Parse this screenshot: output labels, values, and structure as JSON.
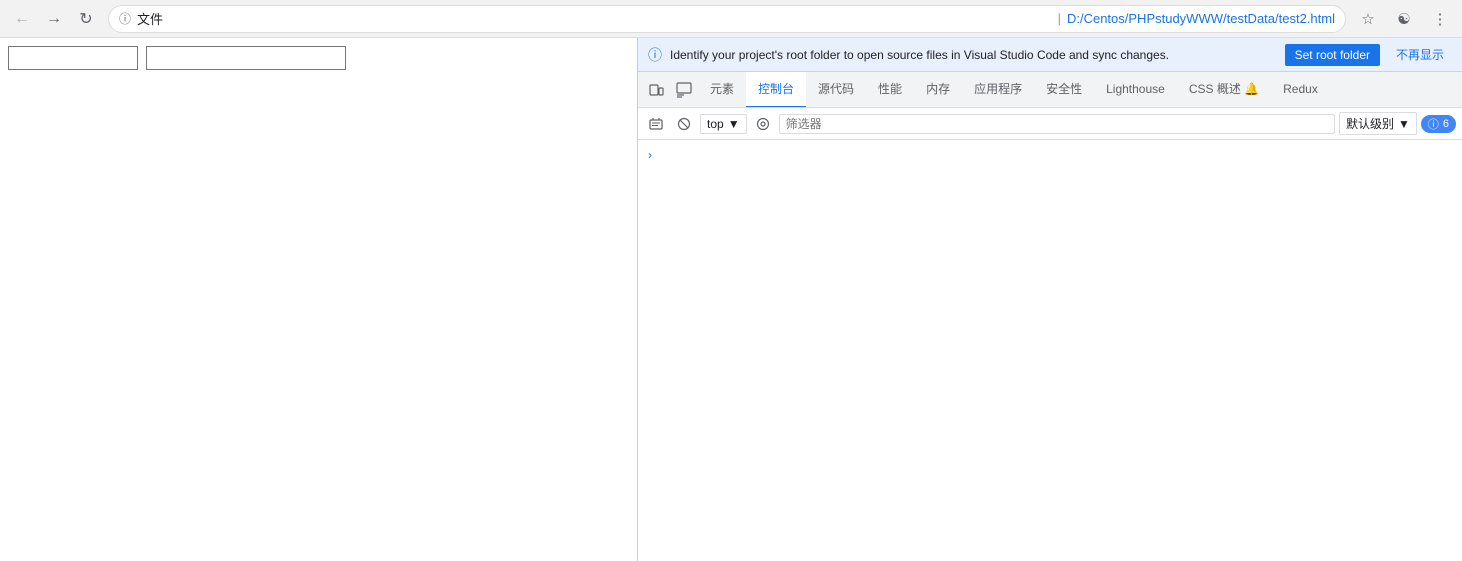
{
  "browser": {
    "back_title": "返回",
    "forward_title": "前进",
    "reload_title": "重新加载",
    "address_label": "文件",
    "address_sep": "|",
    "address_path": "D:/Centos/PHPstudyWWW/testData/test2.html",
    "star_title": "将此网页加入书签",
    "ext_title": "扩展",
    "menu_title": "自定义及控制"
  },
  "page": {
    "input1_placeholder": "",
    "input2_placeholder": ""
  },
  "infobar": {
    "text": "Identify your project's root folder to open source files in Visual Studio Code and sync changes.",
    "set_root_label": "Set root folder",
    "dismiss_label": "不再显示"
  },
  "tabs": [
    {
      "id": "device",
      "label": "📱",
      "icon": true
    },
    {
      "id": "inspect",
      "label": "🔍",
      "icon": true
    },
    {
      "id": "elements",
      "label": "元素"
    },
    {
      "id": "console",
      "label": "控制台",
      "active": true
    },
    {
      "id": "sources",
      "label": "源代码"
    },
    {
      "id": "performance",
      "label": "性能"
    },
    {
      "id": "memory",
      "label": "内存"
    },
    {
      "id": "application",
      "label": "应用程序"
    },
    {
      "id": "security",
      "label": "安全性"
    },
    {
      "id": "lighthouse",
      "label": "Lighthouse"
    },
    {
      "id": "cssoverview",
      "label": "CSS 概述 🔔"
    },
    {
      "id": "redux",
      "label": "Redux"
    }
  ],
  "console_toolbar": {
    "clear_label": "清空控制台",
    "block_label": "不保留日志",
    "context_label": "top",
    "eye_label": "显示实时表达式",
    "filter_placeholder": "筛选器",
    "level_label": "默认级别",
    "issues_count": "6"
  },
  "console_content": {
    "arrow": "›"
  }
}
